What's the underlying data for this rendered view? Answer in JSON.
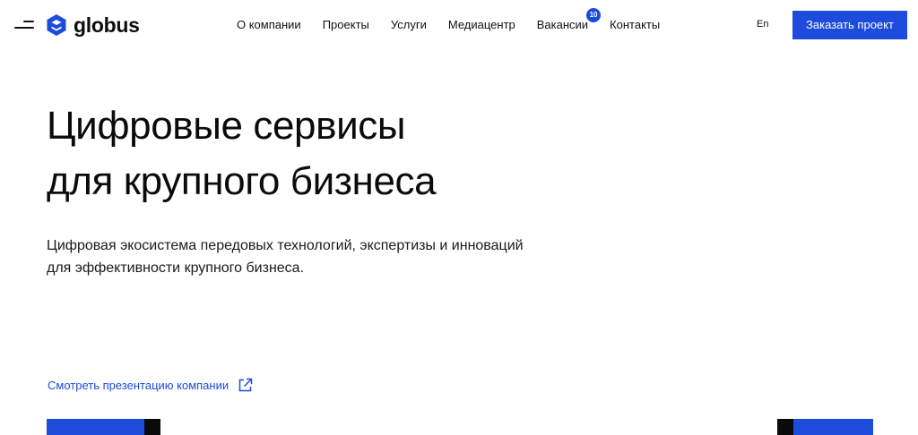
{
  "header": {
    "brand": "globus",
    "nav": [
      {
        "label": "О компании"
      },
      {
        "label": "Проекты"
      },
      {
        "label": "Услуги"
      },
      {
        "label": "Медиацентр"
      },
      {
        "label": "Вакансии",
        "badge": "10"
      },
      {
        "label": "Контакты"
      }
    ],
    "lang": "En",
    "cta_label": "Заказать проект"
  },
  "hero": {
    "title_line1": "Цифровые сервисы",
    "title_line2": "для крупного бизнеса",
    "subtitle_line1": "Цифровая экосистема передовых технологий, экспертизы и инноваций",
    "subtitle_line2": "для эффективности крупного бизнеса.",
    "presentation_link": "Смотреть презентацию компании"
  },
  "icons": {
    "menu": "menu-icon",
    "logo": "globus-logo-icon",
    "external": "external-link-icon"
  },
  "colors": {
    "accent": "#1d4bdc",
    "text": "#111111",
    "background": "#ffffff",
    "dark": "#0a0a0a"
  }
}
